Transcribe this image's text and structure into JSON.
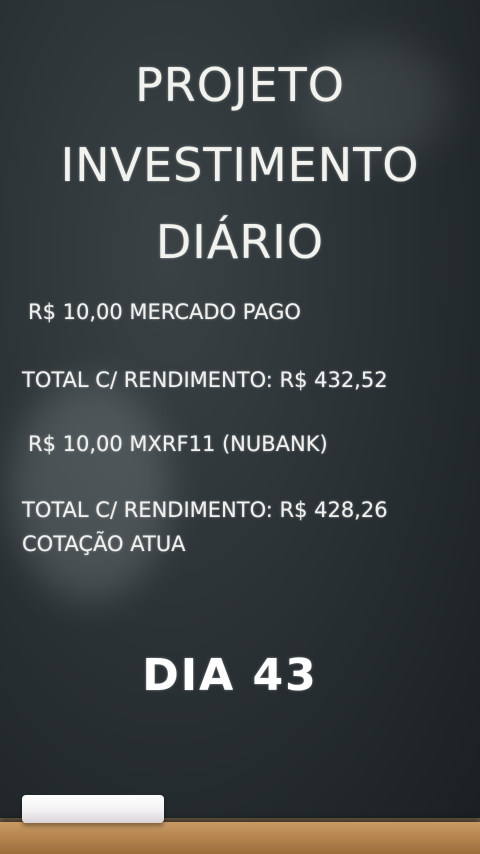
{
  "title": {
    "line1": "PROJETO",
    "line2": "INVESTIMENTO",
    "line3": "DIÁRIO"
  },
  "entries": [
    {
      "text": "R$ 10,00  MERCADO PAGO"
    },
    {
      "text": "TOTAL C/ RENDIMENTO: R$ 432,52"
    },
    {
      "text": "R$ 10,00  MXRF11 (NUBANK)"
    },
    {
      "text": "TOTAL C/ RENDIMENTO: R$ 428,26"
    },
    {
      "text": "COTAÇÃO ATUA"
    }
  ],
  "day_label": "DIA 43",
  "colors": {
    "board": "#2b3236",
    "chalk": "#f2f2ef",
    "tray": "#b78650"
  }
}
